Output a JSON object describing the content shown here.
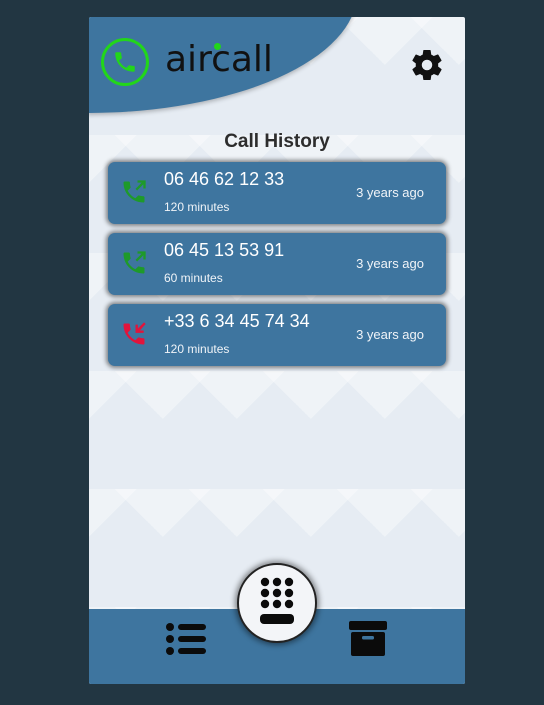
{
  "app": {
    "logo_text": "aircall"
  },
  "history": {
    "title": "Call History",
    "calls": [
      {
        "number": "06 46 62 12 33",
        "duration": "120 minutes",
        "time": "3 years ago",
        "direction": "outgoing"
      },
      {
        "number": "06 45 13 53 91",
        "duration": "60 minutes",
        "time": "3 years ago",
        "direction": "outgoing"
      },
      {
        "number": "+33 6 34 45 74 34",
        "duration": "120 minutes",
        "time": "3 years ago",
        "direction": "missed"
      }
    ]
  },
  "icons": {
    "logo": "phone-circle-icon",
    "settings": "gear-icon",
    "outgoing": "outgoing-call-icon",
    "missed": "missed-call-icon",
    "nav_list": "list-icon",
    "dialpad": "dialpad-icon",
    "archive": "archive-icon"
  },
  "colors": {
    "primary": "#3e759f",
    "background": "#223642",
    "logo_green": "#22d61a",
    "outgoing": "#1e9a2a",
    "missed": "#e0143c"
  }
}
